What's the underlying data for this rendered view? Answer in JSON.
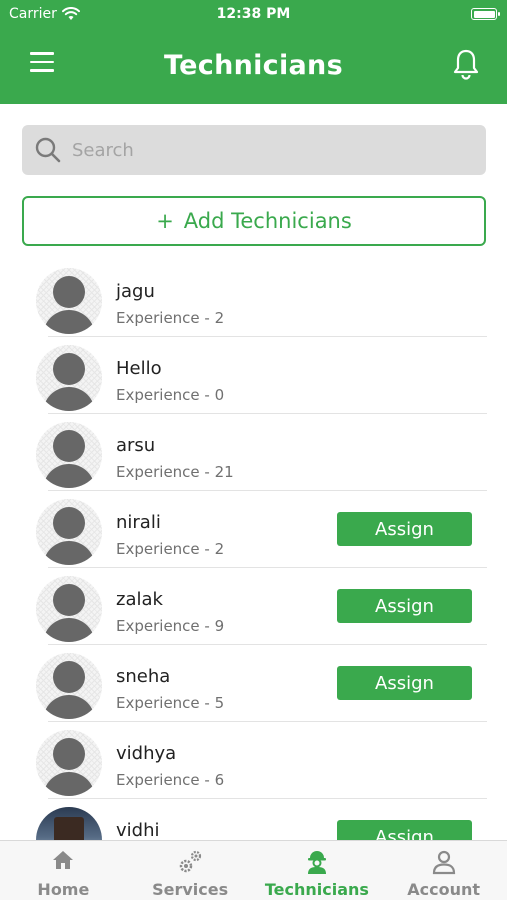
{
  "status_bar": {
    "carrier": "Carrier",
    "time": "12:38 PM"
  },
  "header": {
    "title": "Technicians",
    "menu_icon": "hamburger-menu-icon",
    "notification_icon": "bell-icon"
  },
  "search": {
    "placeholder": "Search",
    "value": ""
  },
  "add_button": {
    "icon": "+",
    "label": "Add Technicians"
  },
  "technicians": [
    {
      "name": "jagu",
      "experience": "Experience - 2",
      "assign": ""
    },
    {
      "name": "Hello",
      "experience": "Experience - 0",
      "assign": ""
    },
    {
      "name": "arsu",
      "experience": "Experience - 21",
      "assign": ""
    },
    {
      "name": "nirali",
      "experience": "Experience - 2",
      "assign": "Assign"
    },
    {
      "name": "zalak",
      "experience": "Experience - 9",
      "assign": "Assign"
    },
    {
      "name": "sneha",
      "experience": "Experience - 5",
      "assign": "Assign"
    },
    {
      "name": "vidhya",
      "experience": "Experience - 6",
      "assign": ""
    },
    {
      "name": "vidhi",
      "experience": "",
      "assign": "Assign",
      "avatar": "photo"
    }
  ],
  "tabs": [
    {
      "label": "Home",
      "icon": "home-icon"
    },
    {
      "label": "Services",
      "icon": "gears-icon"
    },
    {
      "label": "Technicians",
      "icon": "technician-icon",
      "active": true
    },
    {
      "label": "Account",
      "icon": "user-icon"
    }
  ],
  "colors": {
    "primary": "#3aa94d",
    "inactive_tab": "#8a8a8a",
    "search_bg": "#dcdcdc"
  }
}
